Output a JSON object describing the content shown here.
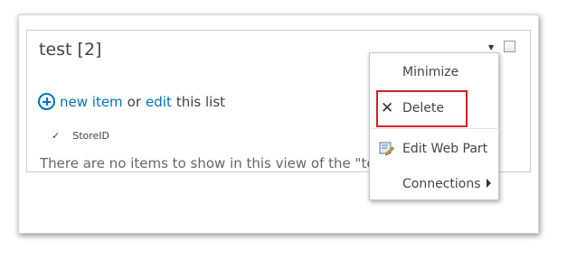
{
  "webpart": {
    "title": "test [2]",
    "new_item_link": "new item",
    "or_text": "or",
    "edit_link": "edit",
    "this_list_text": "this list",
    "column_header": "StoreID",
    "empty_message": "There are no items to show in this view of the \"test\" list."
  },
  "menu": {
    "minimize": "Minimize",
    "delete": "Delete",
    "edit_web_part": "Edit Web Part",
    "connections": "Connections"
  },
  "colors": {
    "link": "#0072c6",
    "highlight_border": "#d1232a"
  }
}
